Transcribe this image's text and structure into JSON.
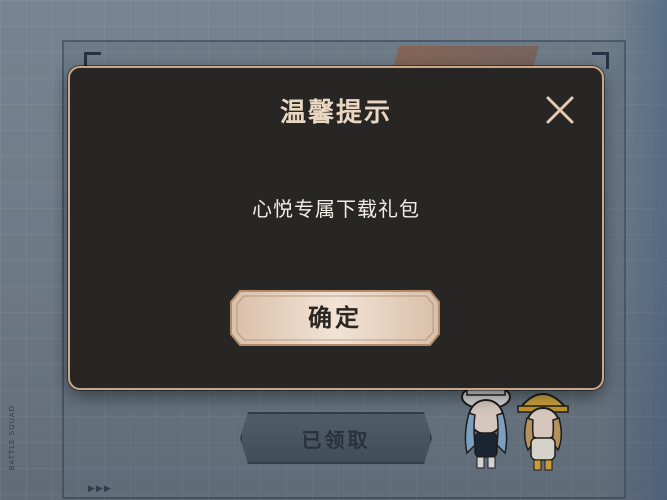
{
  "dialog": {
    "title": "温馨提示",
    "message": "心悦专属下载礼包",
    "confirm_label": "确定",
    "close_icon": "close-icon"
  },
  "background": {
    "claimed_label": "已领取",
    "side_text": "BATTLE SQUAD",
    "arrows": "▶▶▶"
  },
  "colors": {
    "dialog_bg": "#282624",
    "dialog_border": "#c9a889",
    "title_text": "#ead7c1",
    "message_text": "#f2ece4",
    "confirm_bg": "#e6d2c0"
  }
}
